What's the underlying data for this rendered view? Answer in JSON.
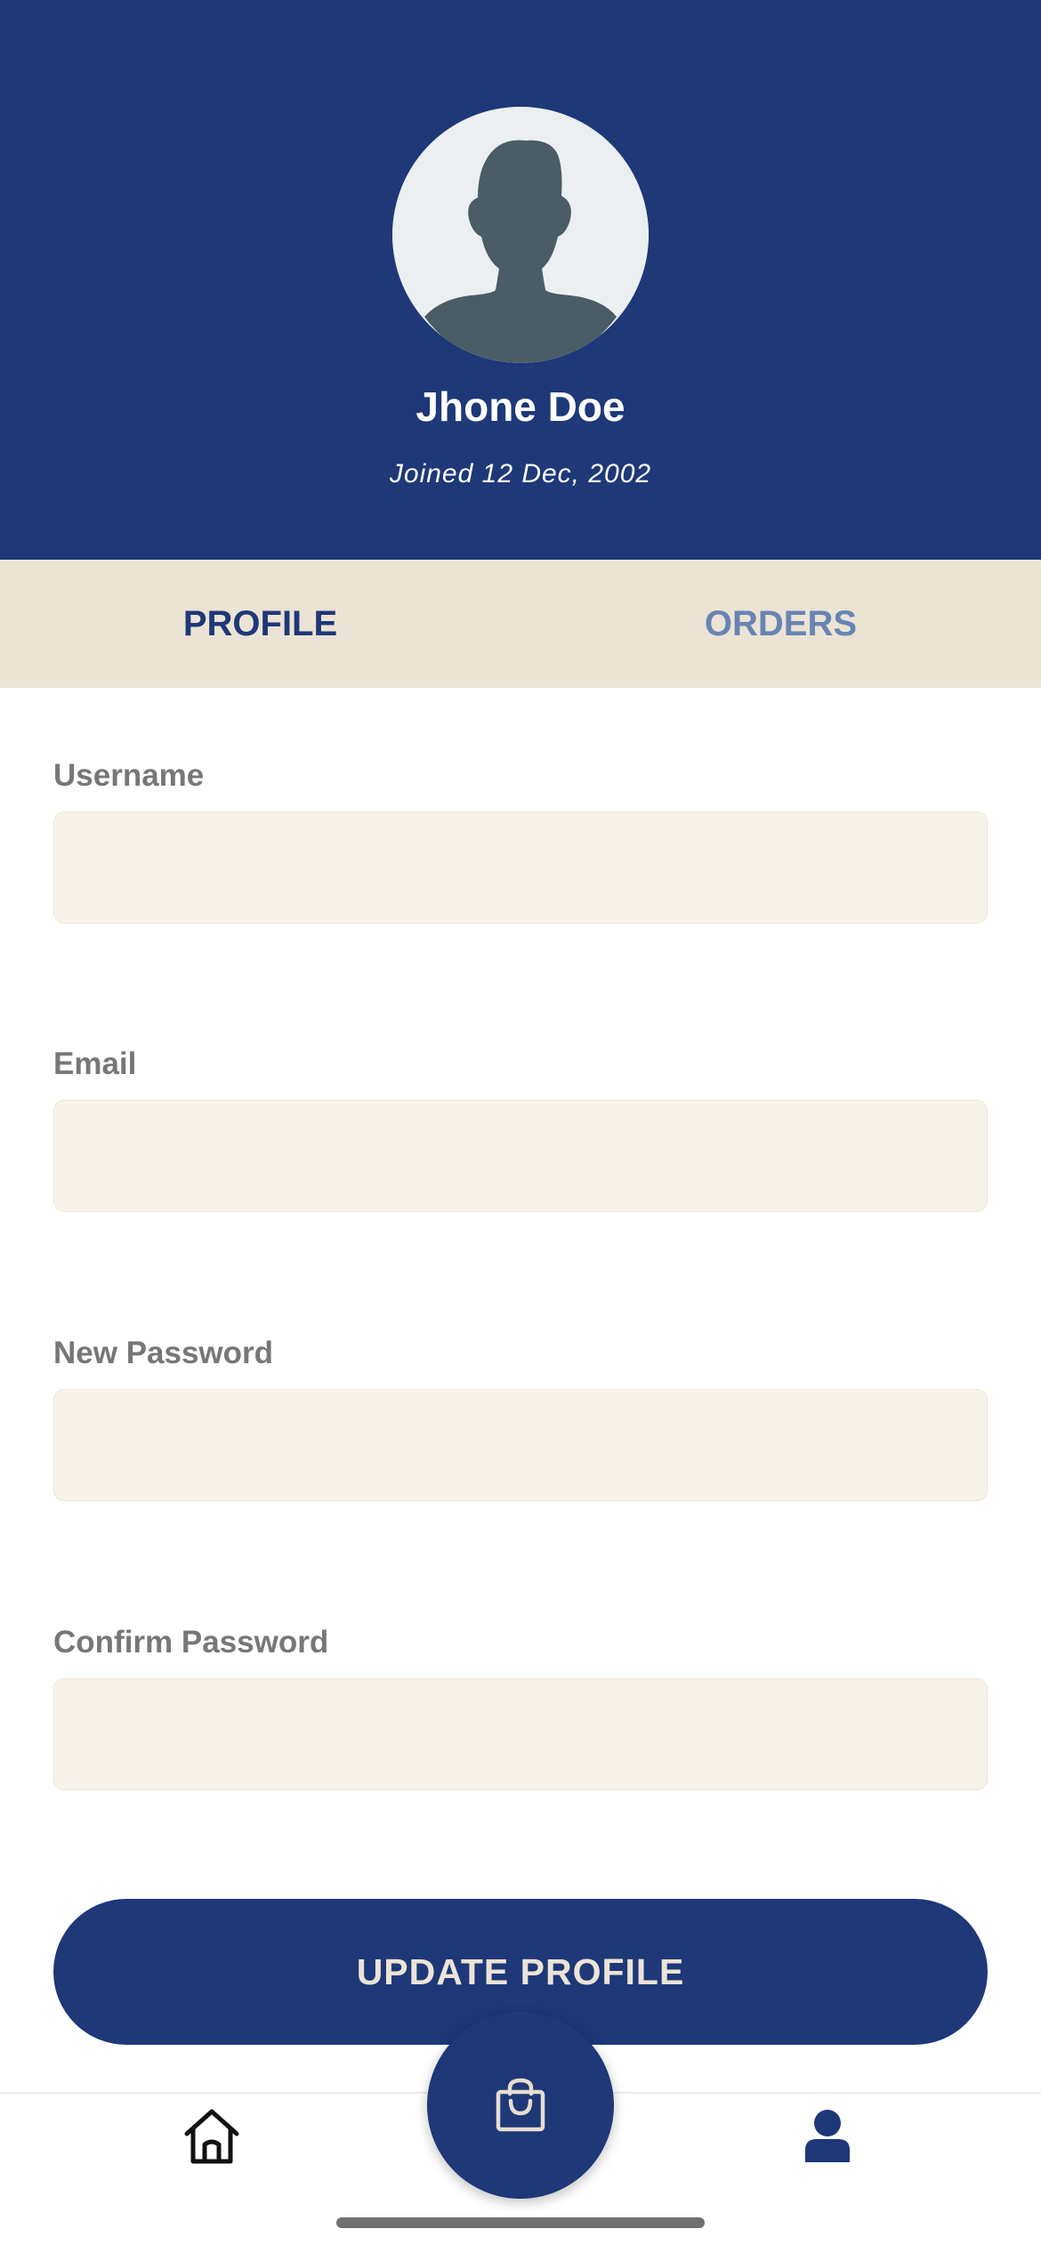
{
  "profile": {
    "name": "Jhone Doe",
    "joined": "Joined 12 Dec, 2002"
  },
  "tabs": [
    {
      "label": "PROFILE",
      "active": true
    },
    {
      "label": "ORDERS",
      "active": false
    }
  ],
  "form": {
    "username": {
      "label": "Username",
      "value": "",
      "placeholder": ""
    },
    "email": {
      "label": "Email",
      "value": "",
      "placeholder": ""
    },
    "new_password": {
      "label": "New Password",
      "value": "",
      "placeholder": ""
    },
    "confirm_password": {
      "label": "Confirm Password",
      "value": "",
      "placeholder": ""
    },
    "submit_label": "UPDATE PROFILE"
  },
  "bottom_nav": {
    "items": [
      {
        "icon": "home-icon"
      },
      {
        "icon": "shopping-bag-icon"
      },
      {
        "icon": "user-icon"
      }
    ]
  },
  "colors": {
    "primary": "#1e3878",
    "tab_bar": "#ebe3d4",
    "input_bg": "#f7f3ea",
    "tab_inactive": "#6884b3",
    "label_gray": "#777777",
    "avatar_silhouette": "#4a5c66"
  }
}
